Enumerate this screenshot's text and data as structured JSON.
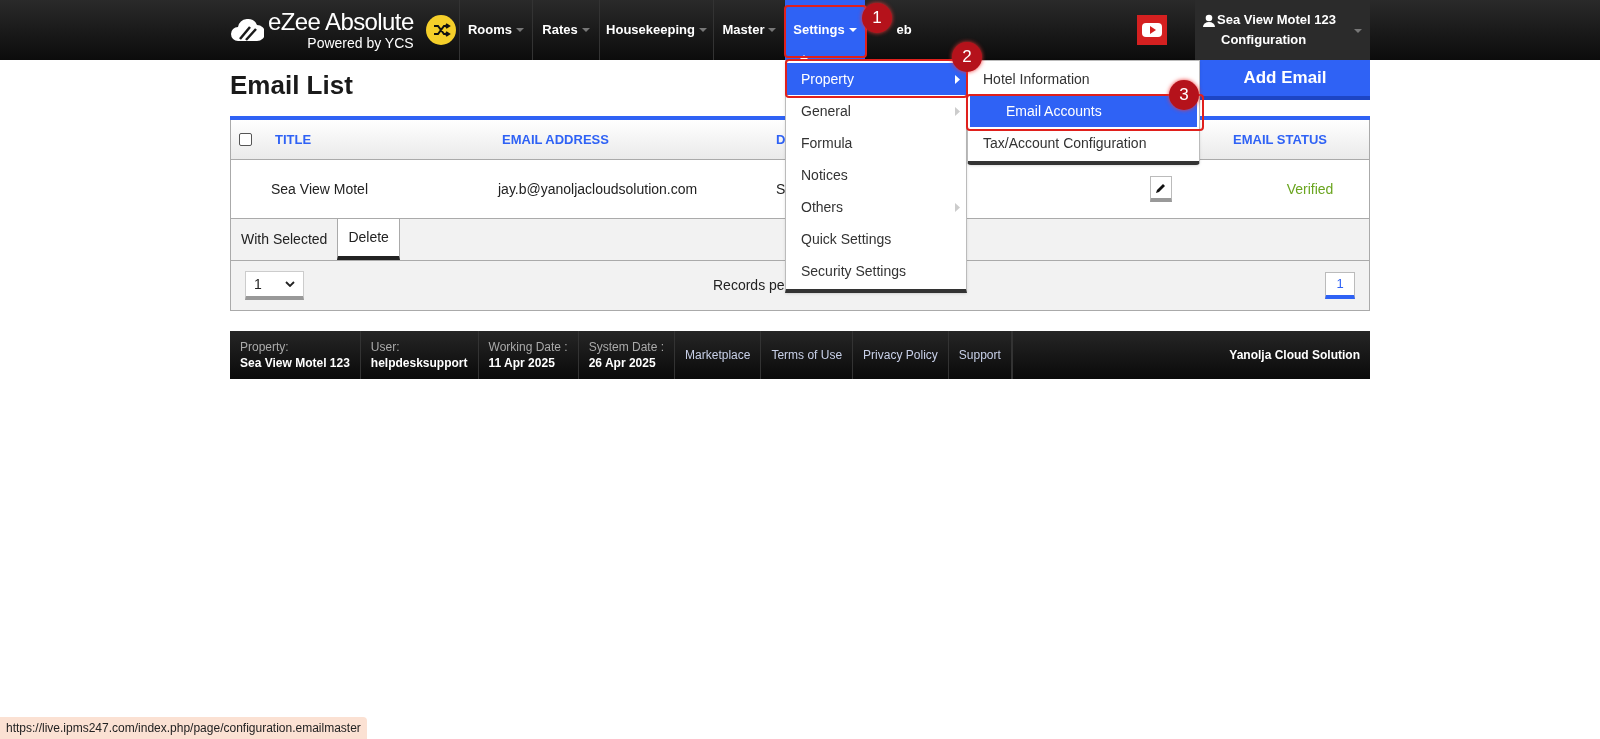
{
  "brand": {
    "name": "eZee Absolute",
    "tagline": "Powered by YCS"
  },
  "nav": [
    {
      "label": "Rooms",
      "selected": false,
      "has_menu": true
    },
    {
      "label": "Rates",
      "selected": false,
      "has_menu": true
    },
    {
      "label": "Housekeeping",
      "selected": false,
      "has_menu": true
    },
    {
      "label": "Master",
      "selected": false,
      "has_menu": true
    },
    {
      "label": "Settings",
      "selected": true,
      "has_menu": true
    },
    {
      "label": "eb",
      "selected": false,
      "has_menu": false
    }
  ],
  "user": {
    "property": "Sea View Motel 123",
    "role": "Configuration"
  },
  "page_title": "Email List",
  "add_button": "Add Email",
  "table": {
    "header_checked": false,
    "columns": [
      "TITLE",
      "EMAIL ADDRESS",
      "D",
      "EMAIL STATUS"
    ],
    "rows": [
      {
        "title": "Sea View Motel",
        "email": "jay.b@yanoljacloudsolution.com",
        "column_3": "S",
        "status": "Verified"
      }
    ]
  },
  "actions": {
    "label": "With Selected",
    "buttons": [
      "Delete"
    ]
  },
  "pager": {
    "page_select": "1",
    "records_label": "Records pe",
    "pages": [
      {
        "label": "1",
        "selected": true
      }
    ]
  },
  "settings_menu": [
    {
      "label": "Property",
      "selected": true,
      "submenu": true
    },
    {
      "label": "General",
      "selected": false,
      "submenu": true
    },
    {
      "label": "Formula",
      "selected": false,
      "submenu": false
    },
    {
      "label": "Notices",
      "selected": false,
      "submenu": false
    },
    {
      "label": "Others",
      "selected": false,
      "submenu": true
    },
    {
      "label": "Quick Settings",
      "selected": false,
      "submenu": false
    },
    {
      "label": "Security Settings",
      "selected": false,
      "submenu": false
    }
  ],
  "property_submenu": [
    {
      "label": "Hotel Information",
      "selected": false
    },
    {
      "label": "Email Accounts",
      "selected": true
    },
    {
      "label": "Tax/Account Configuration",
      "selected": false
    }
  ],
  "annotations": [
    {
      "label": "1"
    },
    {
      "label": "2"
    },
    {
      "label": "3"
    }
  ],
  "footer": {
    "fields": [
      {
        "label": "Property:",
        "value": "Sea View Motel 123"
      },
      {
        "label": "User:",
        "value": "helpdesksupport"
      },
      {
        "label": "Working Date :",
        "value": "11 Apr 2025"
      },
      {
        "label": "System Date :",
        "value": "26 Apr 2025"
      }
    ],
    "links": [
      "Marketplace",
      "Terms of Use",
      "Privacy Policy",
      "Support"
    ],
    "company": "Yanolja Cloud Solution"
  },
  "status_url": "https://live.ipms247.com/index.php/page/configuration.emailmaster"
}
